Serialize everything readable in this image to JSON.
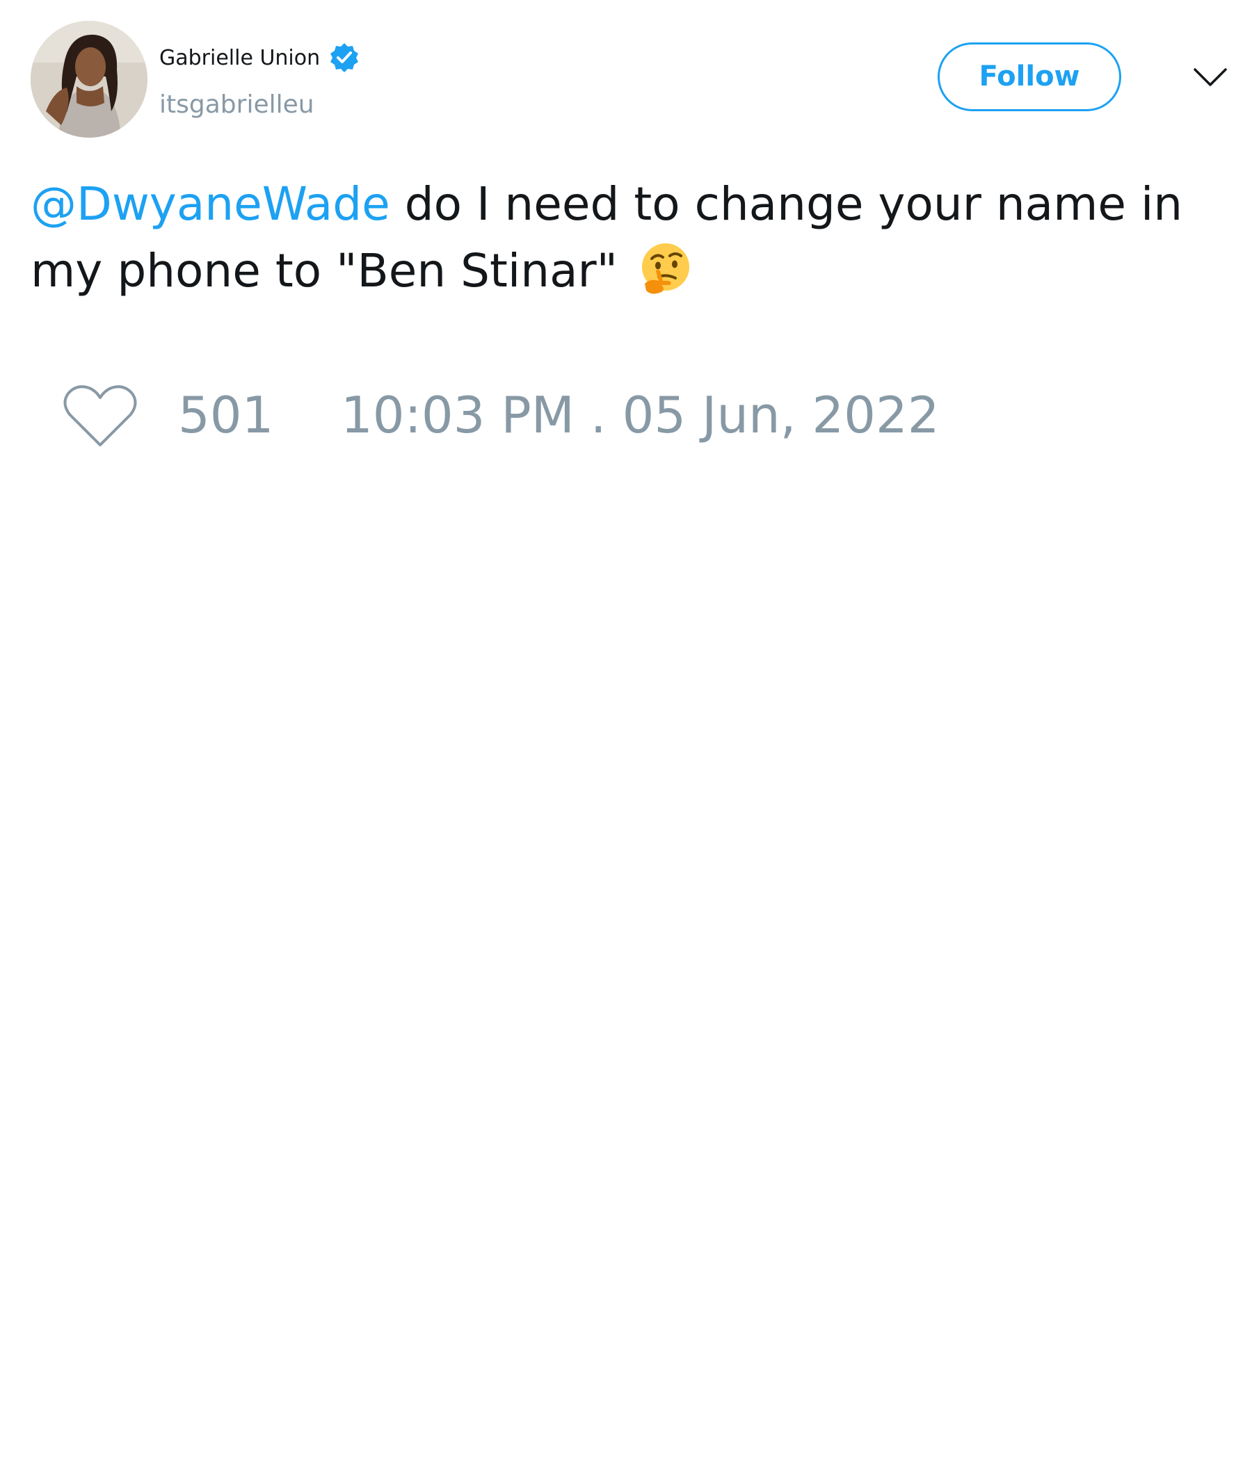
{
  "user": {
    "display_name": "Gabrielle Union",
    "handle": "itsgabrielleu",
    "verified": true,
    "avatar_icon": "profile-photo"
  },
  "header": {
    "follow_label": "Follow",
    "menu_icon": "chevron-down-icon"
  },
  "tweet": {
    "mention": "@DwyaneWade",
    "text": " do I need to change your name in my phone to \"Ben Stinar\" ",
    "emoji": "thinking-face-emoji"
  },
  "footer": {
    "like_icon": "heart-icon",
    "like_count": "501",
    "timestamp": "10:03 PM . 05 Jun, 2022"
  },
  "colors": {
    "accent": "#1da1f2",
    "muted": "#8899a6",
    "text": "#14171a",
    "background": "#ffffff"
  }
}
